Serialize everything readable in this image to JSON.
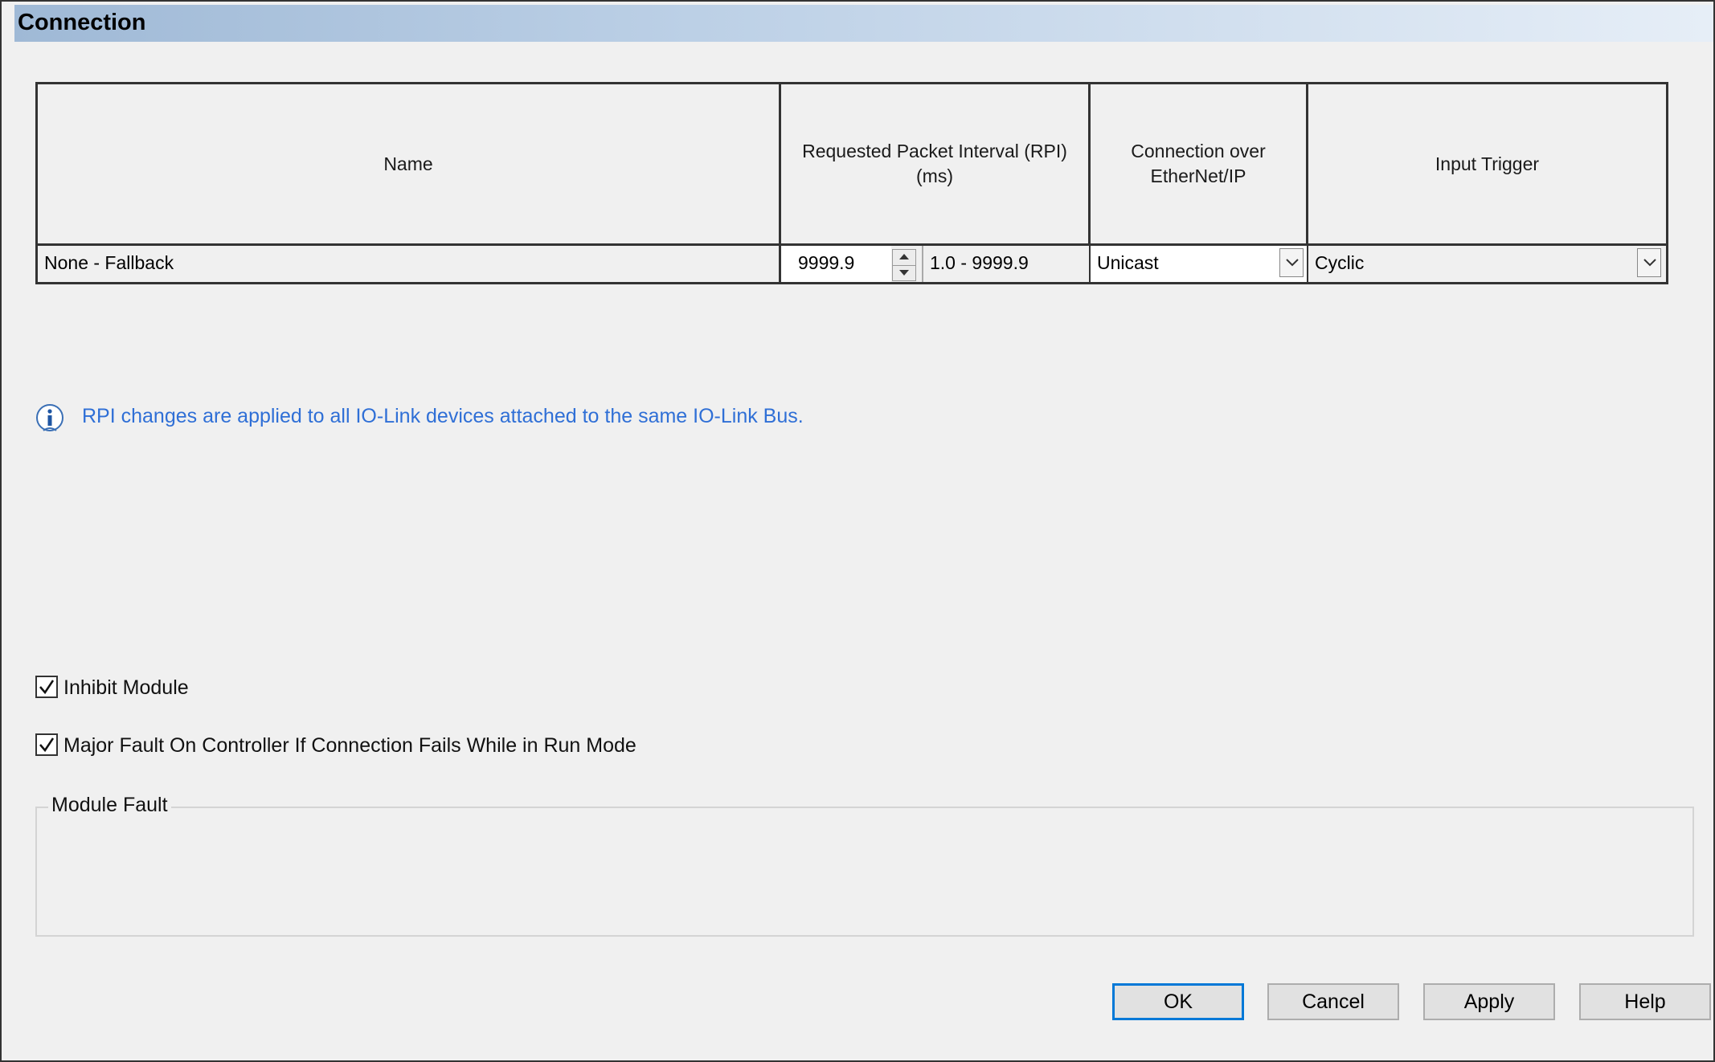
{
  "title": "Connection",
  "table": {
    "headers": {
      "name": "Name",
      "rpi_line1": "Requested Packet Interval (RPI)",
      "rpi_line2": "(ms)",
      "connection_line1": "Connection over",
      "connection_line2": "EtherNet/IP",
      "trigger": "Input Trigger"
    },
    "row": {
      "name": "None - Fallback",
      "rpi_value": "9999.9",
      "rpi_range": "1.0 - 9999.9",
      "connection_value": "Unicast",
      "trigger_value": "Cyclic"
    }
  },
  "info_message": "RPI changes are applied to all IO-Link devices attached to the same IO-Link Bus.",
  "checkboxes": {
    "inhibit_label": "Inhibit Module",
    "inhibit_checked": true,
    "major_fault_label": "Major Fault On Controller If Connection Fails While in Run Mode",
    "major_fault_checked": true
  },
  "module_fault": {
    "legend": "Module Fault"
  },
  "buttons": {
    "ok": "OK",
    "cancel": "Cancel",
    "apply": "Apply",
    "help": "Help"
  },
  "icons": {
    "info": "info-icon",
    "checkmark": "checkmark-icon",
    "dropdown": "chevron-down-icon",
    "spin": "spin-arrows-icon"
  },
  "colors": {
    "info_text": "#2f6fd6",
    "default_button_border": "#0078d7",
    "title_gradient_start": "#9fb9d6"
  }
}
